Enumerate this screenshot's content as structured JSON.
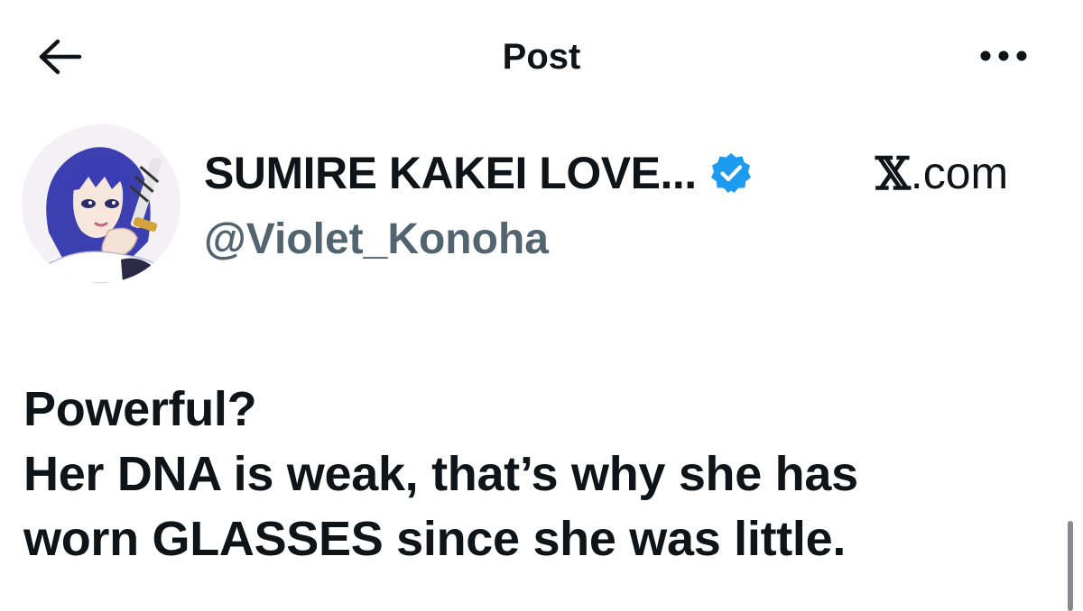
{
  "header": {
    "title": "Post",
    "back_icon": "arrow-left-icon",
    "more_icon": "more-horizontal-icon"
  },
  "author": {
    "display_name": "SUMIRE KAKEI LOVE...",
    "handle": "@Violet_Konoha",
    "verified_icon": "verified-badge-icon",
    "verified_color": "#1d9bf0"
  },
  "source": {
    "logo": "𝕏",
    "suffix": ".com"
  },
  "tweet": {
    "lines": [
      "Powerful?",
      "Her DNA is weak, that’s why she has",
      "worn GLASSES since she was little."
    ]
  },
  "colors": {
    "text_primary": "#0f1419",
    "text_secondary": "#536471",
    "background": "#ffffff"
  }
}
